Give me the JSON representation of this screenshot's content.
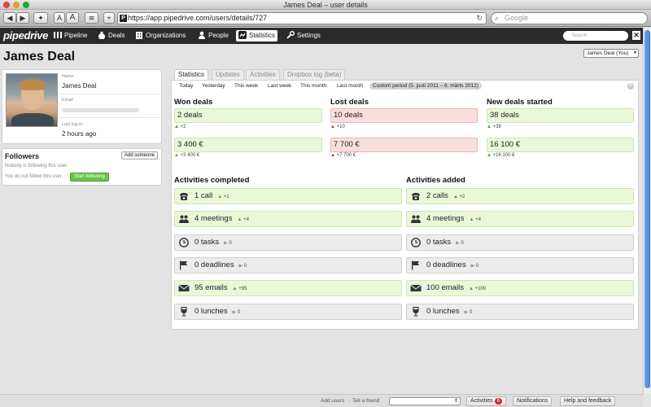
{
  "window": {
    "title": "James Deal – user details",
    "traffic_colors": [
      "#e0443e",
      "#dea123",
      "#1aab29"
    ]
  },
  "toolbar": {
    "url": "https://app.pipedrive.com/users/details/727",
    "search_placeholder": "Google"
  },
  "nav": {
    "logo": "pipedrive",
    "items": [
      {
        "label": "Pipeline",
        "icon": "pipeline-icon"
      },
      {
        "label": "Deals",
        "icon": "deals-icon"
      },
      {
        "label": "Organizations",
        "icon": "organizations-icon"
      },
      {
        "label": "People",
        "icon": "people-icon"
      },
      {
        "label": "Statistics",
        "icon": "statistics-icon",
        "active": true
      },
      {
        "label": "Settings",
        "icon": "settings-icon"
      }
    ],
    "search_placeholder": "Search"
  },
  "page": {
    "title": "James Deal",
    "user_select": "James Deal (You)"
  },
  "profile": {
    "name_label": "Name",
    "name": "James Deal",
    "email_label": "Email",
    "last_login_label": "Last log-in",
    "last_login": "2 hours ago"
  },
  "followers": {
    "title": "Followers",
    "add_button": "Add someone",
    "nobody_text": "Nobody is following this user.",
    "not_following_text": "You do not follow this user.",
    "follow_button": "Start following"
  },
  "tabs": [
    "Statistics",
    "Updates",
    "Activities",
    "Dropbox log (beta)"
  ],
  "periods": [
    "Today",
    "Yesterday",
    "This week",
    "Last week",
    "This month",
    "Last month",
    "Custom period (5. juuli 2011 – 6. märts 2012)"
  ],
  "deals": {
    "won": {
      "title": "Won deals",
      "count": "2 deals",
      "count_delta": "+2",
      "value": "3 400 €",
      "value_delta": "+3 400 €"
    },
    "lost": {
      "title": "Lost deals",
      "count": "10 deals",
      "count_delta": "+10",
      "value": "7 700 €",
      "value_delta": "+7 700 €"
    },
    "new": {
      "title": "New deals started",
      "count": "38 deals",
      "count_delta": "+38",
      "value": "16 100 €",
      "value_delta": "+16 100 €"
    }
  },
  "activities_completed": {
    "title": "Activities completed",
    "rows": [
      {
        "text": "1 call",
        "delta": "+1",
        "trend": "up",
        "icon": "phone-icon"
      },
      {
        "text": "4 meetings",
        "delta": "+4",
        "trend": "up",
        "icon": "meeting-icon"
      },
      {
        "text": "0 tasks",
        "delta": "0",
        "trend": "flat",
        "icon": "clock-icon"
      },
      {
        "text": "0 deadlines",
        "delta": "0",
        "trend": "flat",
        "icon": "flag-icon"
      },
      {
        "text": "95 emails",
        "delta": "+95",
        "trend": "up",
        "icon": "envelope-icon"
      },
      {
        "text": "0 lunches",
        "delta": "0",
        "trend": "flat",
        "icon": "wine-glass-icon"
      }
    ]
  },
  "activities_added": {
    "title": "Activities added",
    "rows": [
      {
        "text": "2 calls",
        "delta": "+2",
        "trend": "up",
        "icon": "phone-icon"
      },
      {
        "text": "4 meetings",
        "delta": "+4",
        "trend": "up",
        "icon": "meeting-icon"
      },
      {
        "text": "0 tasks",
        "delta": "0",
        "trend": "flat",
        "icon": "clock-icon"
      },
      {
        "text": "0 deadlines",
        "delta": "0",
        "trend": "flat",
        "icon": "flag-icon"
      },
      {
        "text": "100 emails",
        "delta": "+100",
        "trend": "up",
        "icon": "envelope-icon"
      },
      {
        "text": "0 lunches",
        "delta": "0",
        "trend": "flat",
        "icon": "wine-glass-icon"
      }
    ]
  },
  "footer": {
    "add_users": "Add users",
    "separator": "·",
    "tell_friend": "Tell a friend",
    "activities": "Activities",
    "activities_count": "6",
    "notifications": "Notifications",
    "help": "Help and feedback"
  }
}
